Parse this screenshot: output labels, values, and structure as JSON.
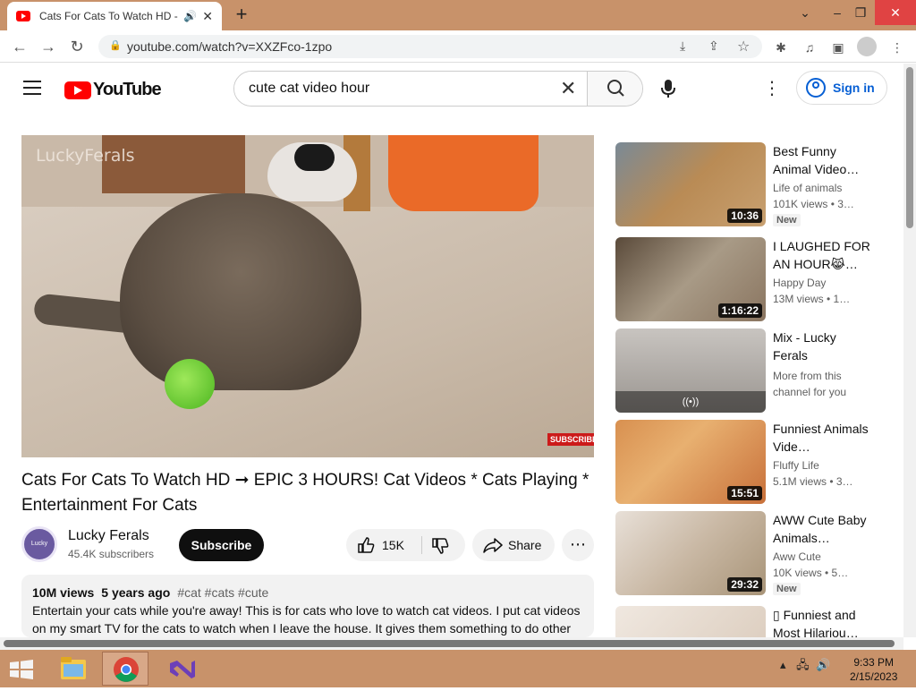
{
  "browser": {
    "tab_title": "Cats For Cats To Watch HD -",
    "url": "youtube.com/watch?v=XXZFco-1zpo"
  },
  "youtube": {
    "brand": "YouTube",
    "search_value": "cute cat video hour",
    "sign_in": "Sign in"
  },
  "video": {
    "watermark": "LuckyFerals",
    "subscribe_badge": "SUBSCRIBE",
    "title": "Cats For Cats To Watch HD ➞ EPIC 3 HOURS! Cat Videos * Cats Playing * Entertainment For Cats",
    "channel": "Lucky Ferals",
    "channel_avatar_text": "Lucky Ferals",
    "subscribers": "45.4K subscribers",
    "subscribe_label": "Subscribe",
    "likes": "15K",
    "share_label": "Share",
    "views": "10M views",
    "age": "5 years ago",
    "tags": "#cat #cats #cute",
    "description": "Entertain your cats while you're away! This is for cats who love to watch cat videos. I put cat videos on my smart TV for the cats to watch when I leave the house. It gives them something to do other"
  },
  "recommendations": [
    {
      "title": "Best Funny Animal Video…",
      "channel": "Life of animals",
      "views": "101K views  • 3…",
      "duration": "10:36",
      "badge": "New",
      "thumb_color": "#b98b55"
    },
    {
      "title": "I LAUGHED FOR AN HOUR😹…",
      "channel": "Happy Day",
      "views": "13M views  • 1…",
      "duration": "1:16:22",
      "badge": "",
      "thumb_color": "#8a7560"
    },
    {
      "title": "Mix - Lucky Ferals",
      "channel": "More from this channel for you",
      "views": "",
      "duration": "",
      "badge": "",
      "thumb_color": "#9a9590",
      "mix_icon": "((•))"
    },
    {
      "title": "Funniest Animals Vide…",
      "channel": "Fluffy Life",
      "views": "5.1M views  • 3…",
      "duration": "15:51",
      "badge": "",
      "thumb_color": "#c8703a"
    },
    {
      "title": "AWW Cute Baby Animals…",
      "channel": "Aww Cute",
      "views": "10K views  • 5…",
      "duration": "29:32",
      "badge": "New",
      "thumb_color": "#c9b8a4"
    },
    {
      "title": "▯ Funniest and Most Hilariou…",
      "channel": "",
      "views": "",
      "duration": "",
      "badge": "",
      "thumb_color": "#d8c8b8"
    }
  ],
  "taskbar": {
    "time": "9:33 PM",
    "date": "2/15/2023"
  }
}
